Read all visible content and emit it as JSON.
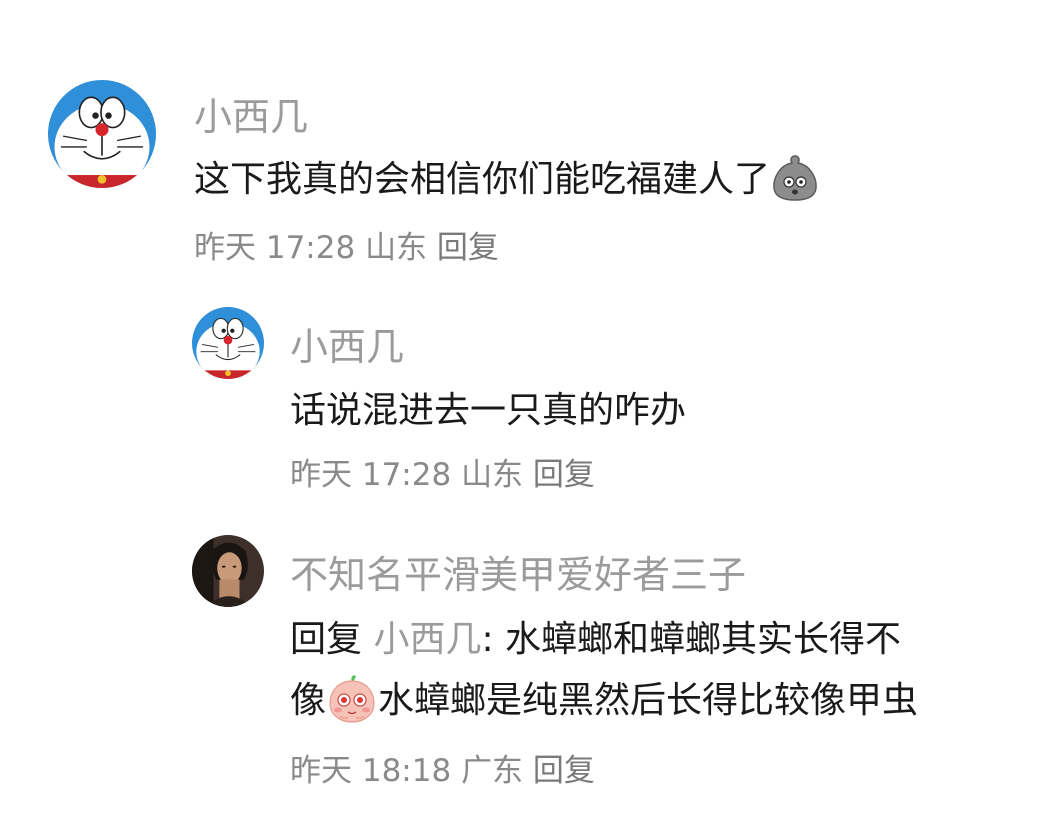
{
  "comments": [
    {
      "name": "小西几",
      "text": "这下我真的会相信你们能吃福建人了",
      "emoji": "shocked-blob-emoji",
      "time": "昨天 17:28",
      "location": "山东",
      "reply": "回复"
    },
    {
      "name": "小西几",
      "text": "话说混进去一只真的咋办",
      "time": "昨天 17:28",
      "location": "山东",
      "reply": "回复"
    },
    {
      "name": "不知名平滑美甲爱好者三子",
      "prefix": "回复",
      "mention": "小西几",
      "line1": ": 水蟑螂和蟑螂其实长得不",
      "line2_a": "像",
      "emoji": "shy-peach-emoji",
      "line2_b": "水蟑螂是纯黑然后长得比较像甲虫",
      "time": "昨天 18:18",
      "location": "广东",
      "reply": "回复"
    }
  ],
  "colors": {
    "name": "#9b9b9b",
    "text": "#1a1a1a",
    "meta": "#8a8a8a"
  }
}
